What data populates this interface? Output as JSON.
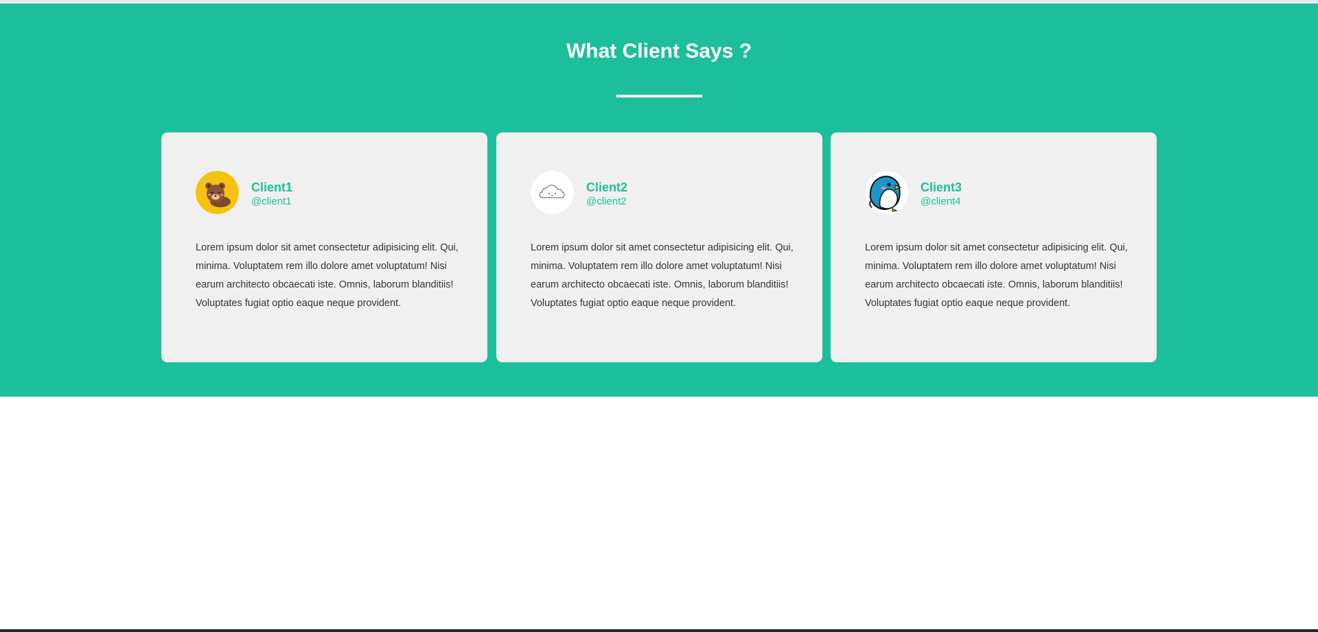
{
  "section": {
    "title": "What Client Says ?",
    "background_color": "#1dbe9b",
    "accent_color": "#1dbe9b",
    "card_color": "#f0f0f0"
  },
  "testimonials": [
    {
      "name": "Client1",
      "handle": "@client1",
      "avatar_icon": "bear-sleeping-icon",
      "text": "Lorem ipsum dolor sit amet consectetur adipisicing elit. Qui, minima. Voluptatem rem illo dolore amet voluptatum! Nisi earum architecto obcaecati iste. Omnis, laborum blanditiis! Voluptates fugiat optio eaque neque provident."
    },
    {
      "name": "Client2",
      "handle": "@client2",
      "avatar_icon": "cloud-icon",
      "text": "Lorem ipsum dolor sit amet consectetur adipisicing elit. Qui, minima. Voluptatem rem illo dolore amet voluptatum! Nisi earum architecto obcaecati iste. Omnis, laborum blanditiis! Voluptates fugiat optio eaque neque provident."
    },
    {
      "name": "Client3",
      "handle": "@client4",
      "avatar_icon": "penguin-icon",
      "text": "Lorem ipsum dolor sit amet consectetur adipisicing elit. Qui, minima. Voluptatem rem illo dolore amet voluptatum! Nisi earum architecto obcaecati iste. Omnis, laborum blanditiis! Voluptates fugiat optio eaque neque provident."
    }
  ]
}
